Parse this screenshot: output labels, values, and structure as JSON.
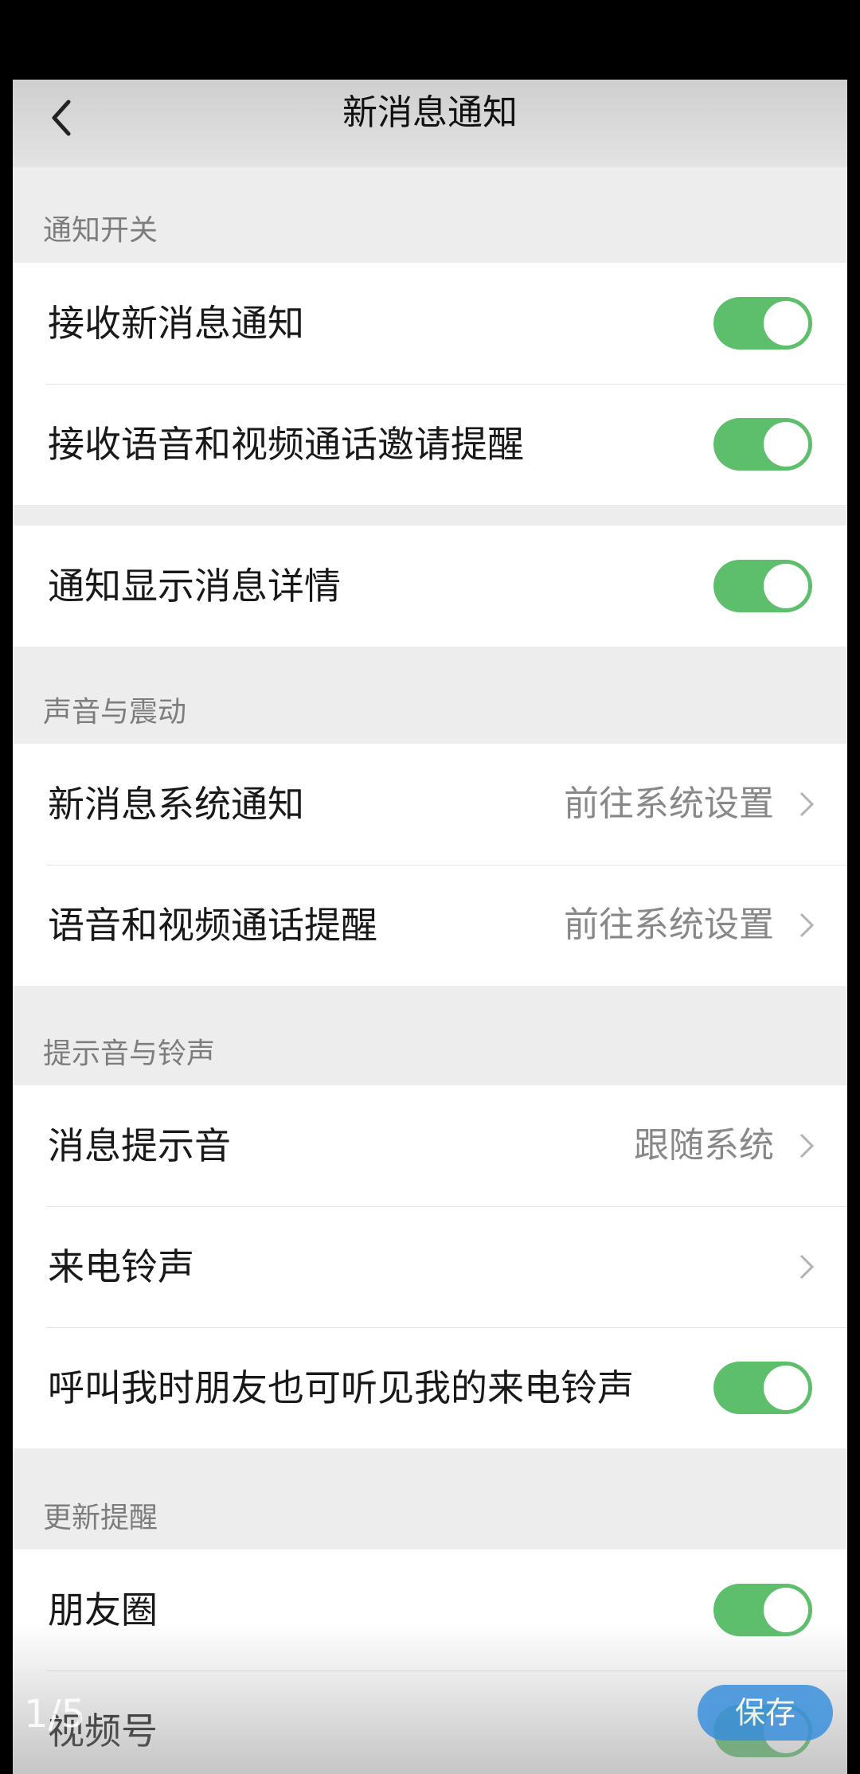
{
  "nav": {
    "title": "新消息通知"
  },
  "sections": [
    {
      "header": "通知开关"
    },
    {
      "header": "声音与震动"
    },
    {
      "header": "提示音与铃声"
    },
    {
      "header": "更新提醒"
    }
  ],
  "rows": {
    "receive_new": {
      "label": "接收新消息通知",
      "toggle_on": true
    },
    "call_invite": {
      "label": "接收语音和视频通话邀请提醒",
      "toggle_on": true
    },
    "show_details": {
      "label": "通知显示消息详情",
      "toggle_on": true
    },
    "system_notify": {
      "label": "新消息系统通知",
      "value": "前往系统设置"
    },
    "call_remind": {
      "label": "语音和视频通话提醒",
      "value": "前往系统设置"
    },
    "msg_tone": {
      "label": "消息提示音",
      "value": "跟随系统"
    },
    "ringtone": {
      "label": "来电铃声"
    },
    "friends_hear": {
      "label": "呼叫我时朋友也可听见我的来电铃声",
      "toggle_on": true
    },
    "moments": {
      "label": "朋友圈",
      "toggle_on": true
    },
    "channels": {
      "label": "视频号",
      "toggle_on": true
    }
  },
  "overlay": {
    "page_counter": "1/5",
    "save_label": "保存"
  },
  "colors": {
    "toggle_on": "#5dbf6c",
    "save_button": "#3a8fdc",
    "background": "#ededed"
  }
}
